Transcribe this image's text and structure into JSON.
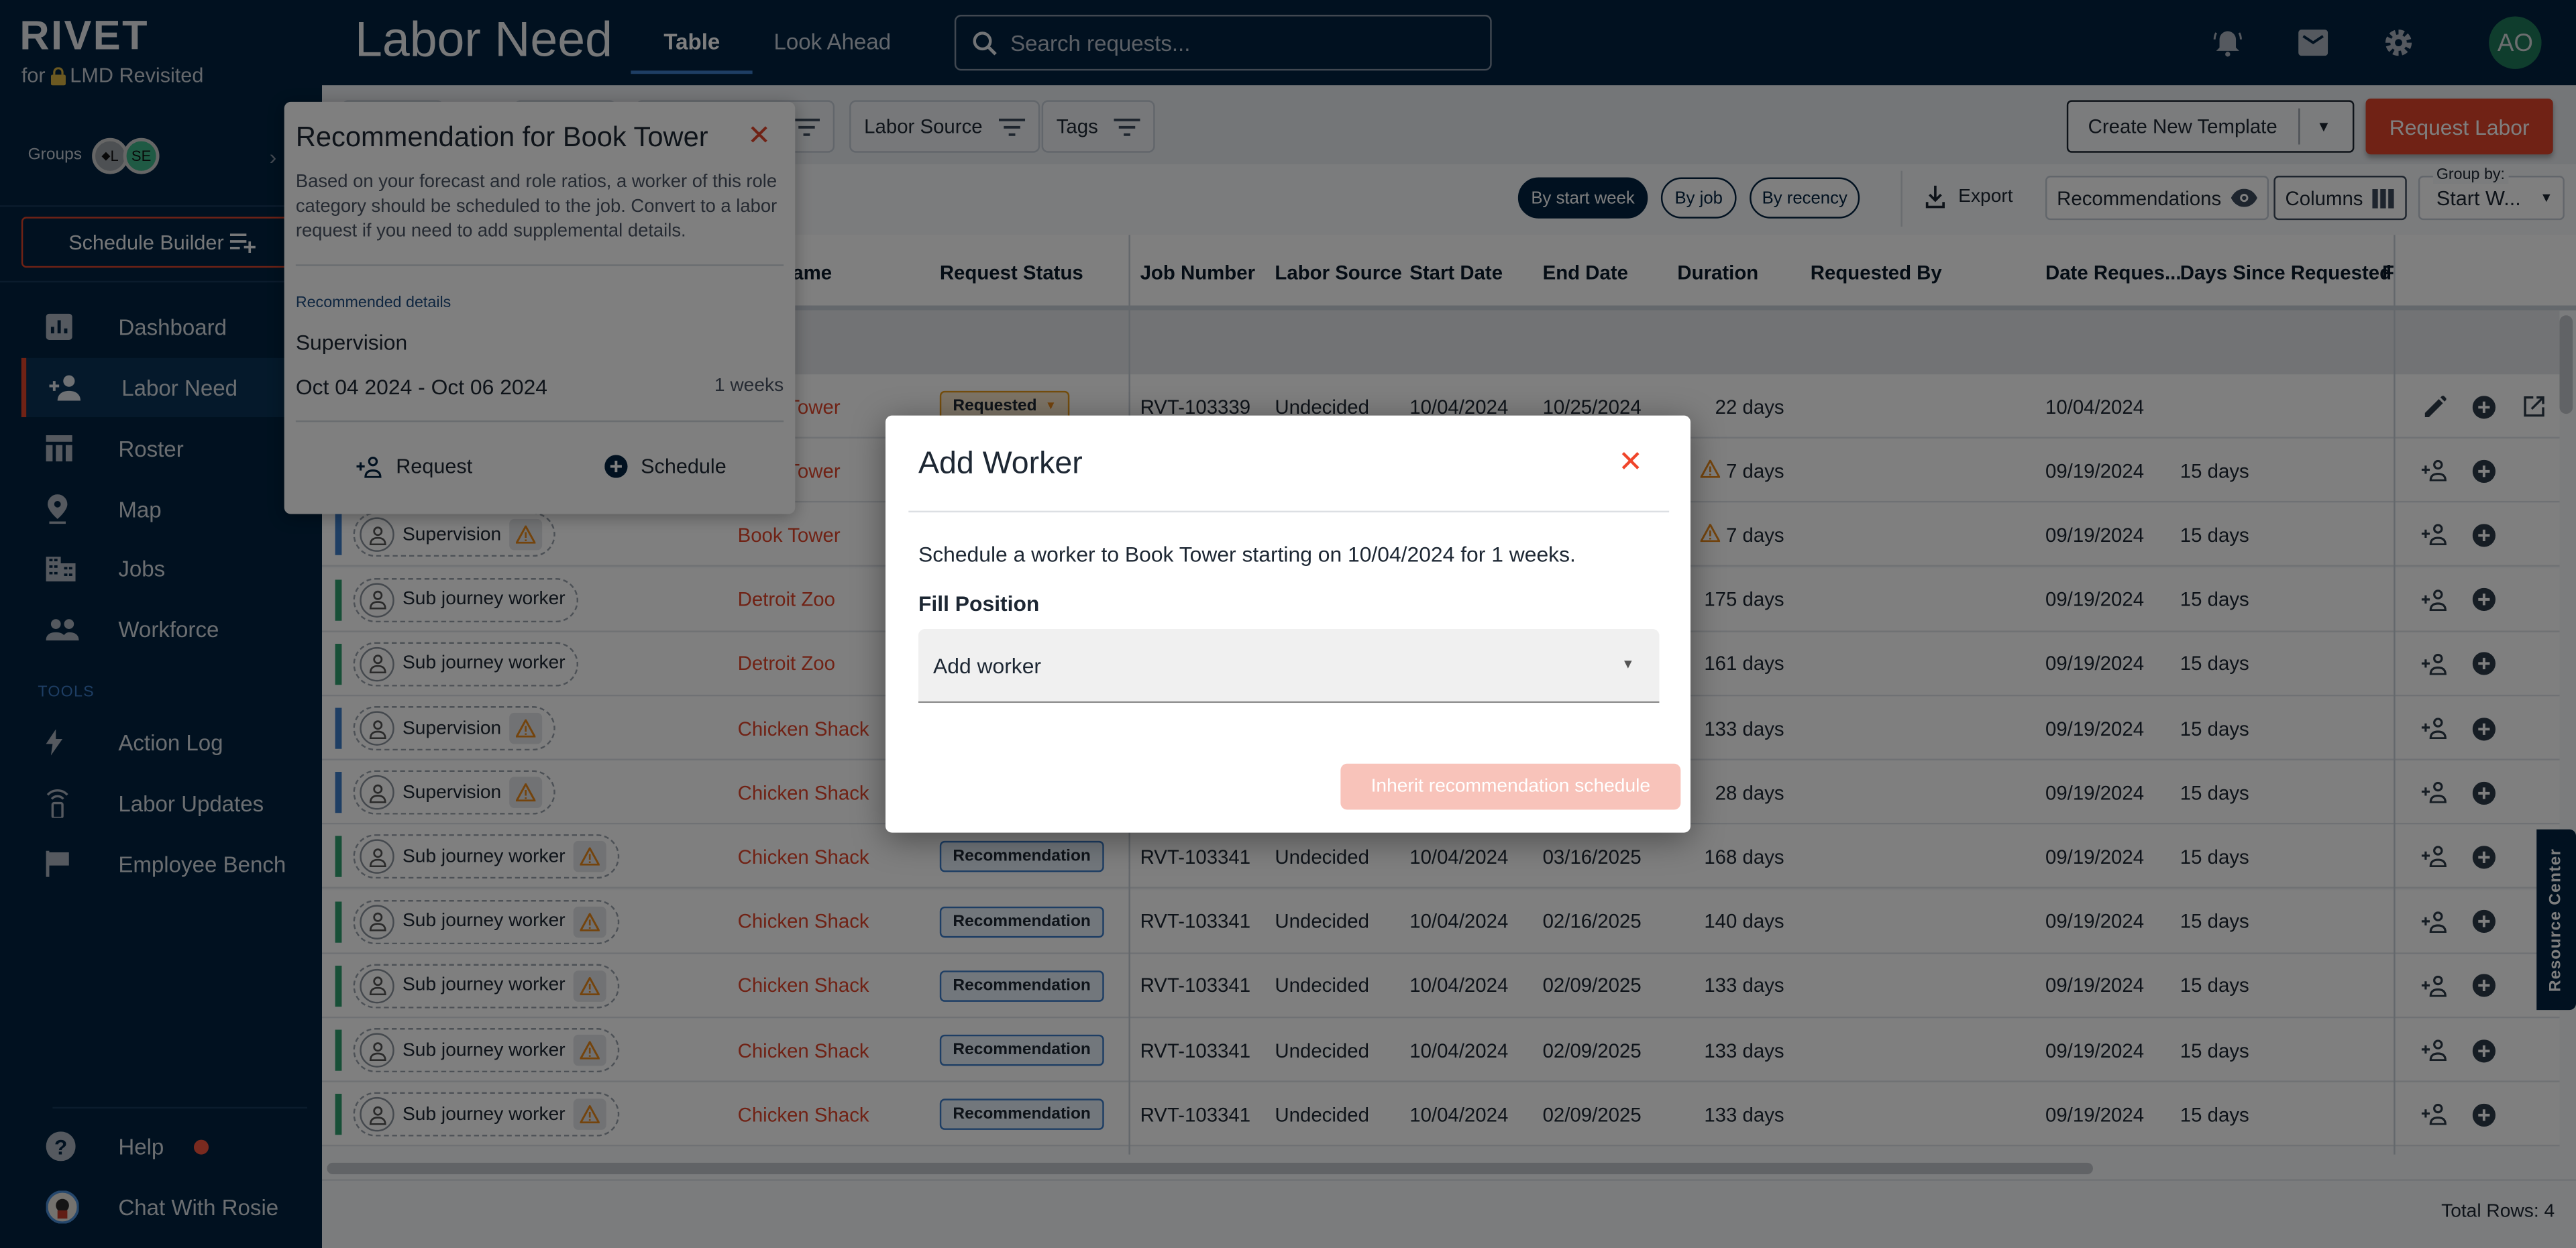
{
  "app": {
    "logo": "RIVET",
    "subtitle_prefix": "for",
    "org_name": "LMD Revisited",
    "lock_icon": "lock-icon"
  },
  "header": {
    "title": "Labor Need",
    "tabs": [
      {
        "label": "Table",
        "active": true
      },
      {
        "label": "Look Ahead",
        "active": false
      }
    ],
    "search_placeholder": "Search requests...",
    "icons": [
      "bell-ring-icon",
      "mail-icon",
      "gear-icon"
    ],
    "avatar": "AO"
  },
  "sidebar": {
    "groups_label": "Groups",
    "group_badges": [
      "L",
      "SE"
    ],
    "schedule_builder": "Schedule Builder",
    "nav": [
      {
        "label": "Dashboard",
        "icon": "bar-chart-icon"
      },
      {
        "label": "Labor Need",
        "icon": "person-add-icon",
        "active": true
      },
      {
        "label": "Roster",
        "icon": "table-icon"
      },
      {
        "label": "Map",
        "icon": "map-pin-icon"
      },
      {
        "label": "Jobs",
        "icon": "building-icon"
      },
      {
        "label": "Workforce",
        "icon": "people-icon"
      }
    ],
    "tools_label": "TOOLS",
    "tools": [
      {
        "label": "Action Log",
        "icon": "bolt-icon"
      },
      {
        "label": "Labor Updates",
        "icon": "phone-signal-icon"
      },
      {
        "label": "Employee Bench",
        "icon": "flag-icon"
      }
    ],
    "help": "Help",
    "chat": "Chat With Rosie"
  },
  "toolbar": {
    "filters": [
      "Labor Source",
      "Tags"
    ],
    "create_template": "Create New Template",
    "request_labor": "Request Labor",
    "sort_pills": [
      {
        "label": "By start week",
        "active": true
      },
      {
        "label": "By job"
      },
      {
        "label": "By recency"
      }
    ],
    "export": "Export",
    "recommendations": "Recommendations",
    "columns": "Columns",
    "group_by_label": "Group by:",
    "group_by_value": "Start W..."
  },
  "table": {
    "columns": [
      "Job Name",
      "Request Status",
      "Job Number",
      "Labor Source",
      "Start Date",
      "End Date",
      "Duration",
      "Requested By",
      "Date Reques...",
      "Days Since Requested",
      "F"
    ],
    "rows": [
      {
        "role": "",
        "role_color": "",
        "warn": false,
        "job": "Book Tower",
        "status": "Requested",
        "job_number": "RVT-103339",
        "labor_source": "Undecided",
        "start": "10/04/2024",
        "end": "10/25/2024",
        "duration": "22 days",
        "duration_warn": false,
        "requested_by": "",
        "date_requested": "10/04/2024",
        "days_since": "",
        "actions": [
          "edit",
          "add",
          "open"
        ]
      },
      {
        "role": "",
        "role_color": "",
        "warn": false,
        "job": "Book Tower",
        "status": "",
        "job_number": "",
        "labor_source": "",
        "start": "",
        "end": "",
        "duration": "7 days",
        "duration_warn": true,
        "requested_by": "",
        "date_requested": "09/19/2024",
        "days_since": "15 days",
        "actions": [
          "person-add",
          "add"
        ]
      },
      {
        "role": "Supervision",
        "role_color": "#3d7dc9",
        "warn": true,
        "job": "Book Tower",
        "status": "",
        "job_number": "",
        "labor_source": "",
        "start": "",
        "end": "",
        "duration": "7 days",
        "duration_warn": true,
        "requested_by": "",
        "date_requested": "09/19/2024",
        "days_since": "15 days",
        "actions": [
          "person-add",
          "add"
        ]
      },
      {
        "role": "Sub journey worker",
        "role_color": "#2e9e6e",
        "warn": false,
        "job": "Detroit Zoo",
        "status": "",
        "job_number": "",
        "labor_source": "",
        "start": "",
        "end": "",
        "duration": "175 days",
        "duration_warn": false,
        "requested_by": "",
        "date_requested": "09/19/2024",
        "days_since": "15 days",
        "actions": [
          "person-add",
          "add"
        ]
      },
      {
        "role": "Sub journey worker",
        "role_color": "#2e9e6e",
        "warn": false,
        "job": "Detroit Zoo",
        "status": "",
        "job_number": "",
        "labor_source": "",
        "start": "",
        "end": "",
        "duration": "161 days",
        "duration_warn": false,
        "requested_by": "",
        "date_requested": "09/19/2024",
        "days_since": "15 days",
        "actions": [
          "person-add",
          "add"
        ]
      },
      {
        "role": "Supervision",
        "role_color": "#3d7dc9",
        "warn": true,
        "job": "Chicken Shack",
        "status": "",
        "job_number": "",
        "labor_source": "",
        "start": "",
        "end": "",
        "duration": "133 days",
        "duration_warn": false,
        "requested_by": "",
        "date_requested": "09/19/2024",
        "days_since": "15 days",
        "actions": [
          "person-add",
          "add"
        ]
      },
      {
        "role": "Supervision",
        "role_color": "#3d7dc9",
        "warn": true,
        "job": "Chicken Shack",
        "status": "",
        "job_number": "",
        "labor_source": "",
        "start": "",
        "end": "",
        "duration": "28 days",
        "duration_warn": false,
        "requested_by": "",
        "date_requested": "09/19/2024",
        "days_since": "15 days",
        "actions": [
          "person-add",
          "add"
        ]
      },
      {
        "role": "Sub journey worker",
        "role_color": "#2e9e6e",
        "warn": true,
        "job": "Chicken Shack",
        "status": "Recommendation",
        "job_number": "RVT-103341",
        "labor_source": "Undecided",
        "start": "10/04/2024",
        "end": "03/16/2025",
        "duration": "168 days",
        "duration_warn": false,
        "requested_by": "",
        "date_requested": "09/19/2024",
        "days_since": "15 days",
        "actions": [
          "person-add",
          "add"
        ]
      },
      {
        "role": "Sub journey worker",
        "role_color": "#2e9e6e",
        "warn": true,
        "job": "Chicken Shack",
        "status": "Recommendation",
        "job_number": "RVT-103341",
        "labor_source": "Undecided",
        "start": "10/04/2024",
        "end": "02/16/2025",
        "duration": "140 days",
        "duration_warn": false,
        "requested_by": "",
        "date_requested": "09/19/2024",
        "days_since": "15 days",
        "actions": [
          "person-add",
          "add"
        ]
      },
      {
        "role": "Sub journey worker",
        "role_color": "#2e9e6e",
        "warn": true,
        "job": "Chicken Shack",
        "status": "Recommendation",
        "job_number": "RVT-103341",
        "labor_source": "Undecided",
        "start": "10/04/2024",
        "end": "02/09/2025",
        "duration": "133 days",
        "duration_warn": false,
        "requested_by": "",
        "date_requested": "09/19/2024",
        "days_since": "15 days",
        "actions": [
          "person-add",
          "add"
        ]
      },
      {
        "role": "Sub journey worker",
        "role_color": "#2e9e6e",
        "warn": true,
        "job": "Chicken Shack",
        "status": "Recommendation",
        "job_number": "RVT-103341",
        "labor_source": "Undecided",
        "start": "10/04/2024",
        "end": "02/09/2025",
        "duration": "133 days",
        "duration_warn": false,
        "requested_by": "",
        "date_requested": "09/19/2024",
        "days_since": "15 days",
        "actions": [
          "person-add",
          "add"
        ]
      },
      {
        "role": "Sub journey worker",
        "role_color": "#2e9e6e",
        "warn": true,
        "job": "Chicken Shack",
        "status": "Recommendation",
        "job_number": "RVT-103341",
        "labor_source": "Undecided",
        "start": "10/04/2024",
        "end": "02/09/2025",
        "duration": "133 days",
        "duration_warn": false,
        "requested_by": "",
        "date_requested": "09/19/2024",
        "days_since": "15 days",
        "actions": [
          "person-add",
          "add"
        ]
      }
    ],
    "total_rows": "Total Rows: 4"
  },
  "resource_center": "Resource Center",
  "popover": {
    "title": "Recommendation for Book Tower",
    "description": "Based on your forecast and role ratios, a worker of this role category should be scheduled to the job. Convert to a labor request if you need to add supplemental details.",
    "details_label": "Recommended details",
    "role": "Supervision",
    "date_range": "Oct 04 2024 - Oct 06 2024",
    "duration": "1 weeks",
    "request": "Request",
    "schedule": "Schedule"
  },
  "modal": {
    "title": "Add Worker",
    "message": "Schedule a worker to Book Tower starting on 10/04/2024 for 1 weeks.",
    "fill_label": "Fill Position",
    "select_value": "Add worker",
    "inherit_button": "Inherit recommendation schedule"
  },
  "colors": {
    "navy": "#022340",
    "accent_red": "#e0452a",
    "supervision": "#3d7dc9",
    "sub_journey": "#2e9e6e",
    "warning": "#e89a1a",
    "avatar": "#1f7a5a"
  }
}
